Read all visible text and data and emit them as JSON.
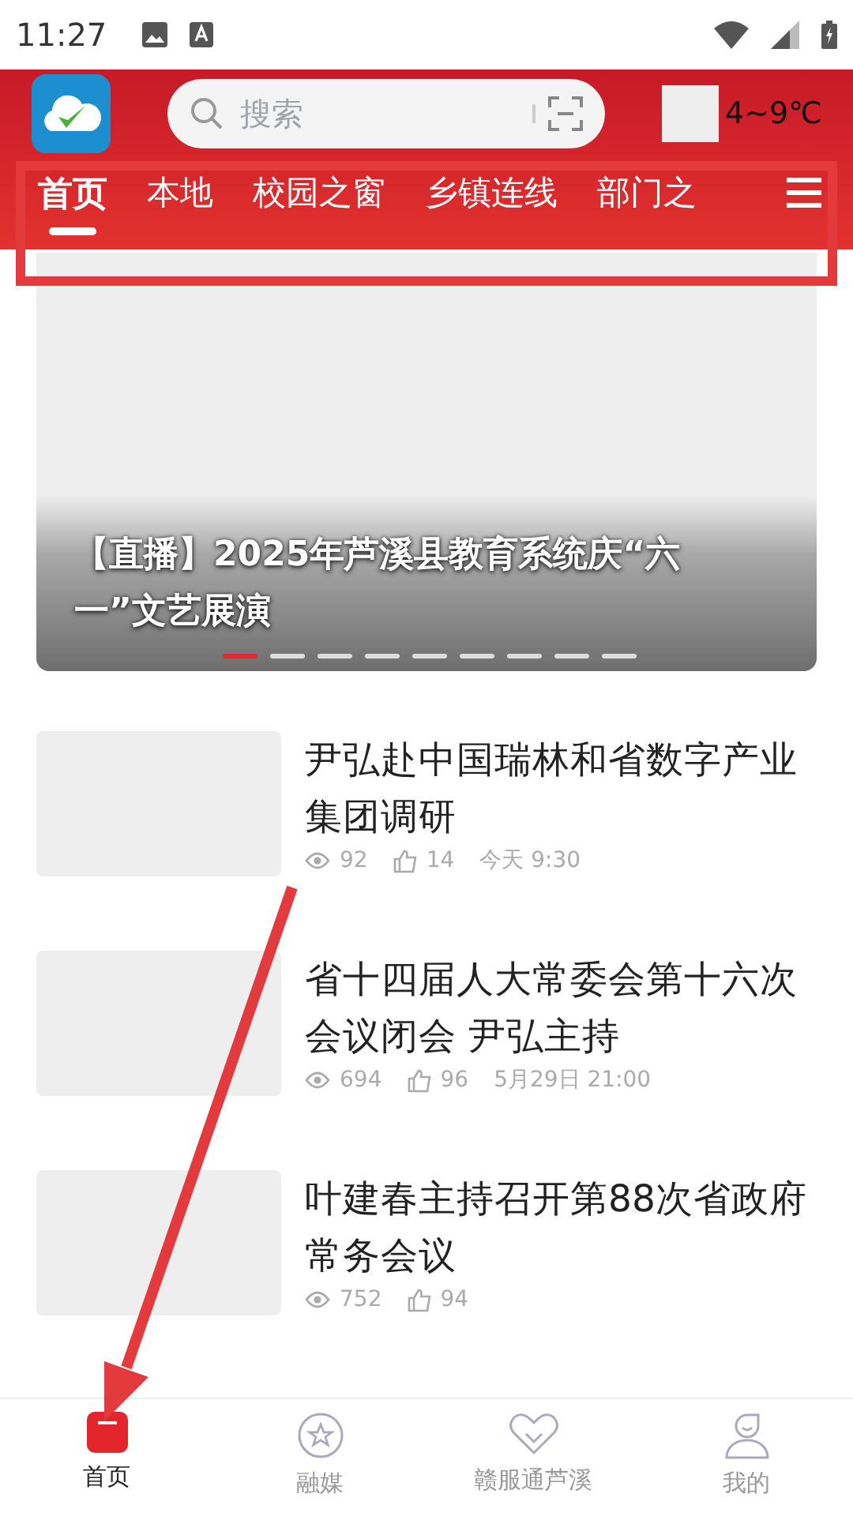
{
  "status_bar": {
    "time": "11:27"
  },
  "header": {
    "search": {
      "placeholder": "搜索"
    },
    "weather": "4~9℃"
  },
  "tabs": [
    {
      "label": "首页",
      "selected": true
    },
    {
      "label": "本地",
      "selected": false
    },
    {
      "label": "校园之窗",
      "selected": false
    },
    {
      "label": "乡镇连线",
      "selected": false
    },
    {
      "label": "部门之",
      "selected": false
    }
  ],
  "banner": {
    "title": "【直播】2025年芦溪县教育系统庆“六一”文艺展演",
    "pages": [
      {
        "selected": true
      },
      {
        "selected": false
      },
      {
        "selected": false
      },
      {
        "selected": false
      },
      {
        "selected": false
      },
      {
        "selected": false
      },
      {
        "selected": false
      },
      {
        "selected": false
      },
      {
        "selected": false
      }
    ]
  },
  "news": [
    {
      "title": "尹弘赴中国瑞林和省数字产业集团调研",
      "views": "92",
      "likes": "14",
      "time": "今天 9:30"
    },
    {
      "title": "省十四届人大常委会第十六次会议闭会 尹弘主持",
      "views": "694",
      "likes": "96",
      "time": "5月29日 21:00"
    },
    {
      "title": "叶建春主持召开第88次省政府常务会议",
      "views": "752",
      "likes": "94"
    }
  ],
  "bottom_nav": [
    {
      "label": "首页",
      "selected": true
    },
    {
      "label": "融媒",
      "selected": false
    },
    {
      "label": "赣服通芦溪",
      "selected": false
    },
    {
      "label": "我的",
      "selected": false
    }
  ]
}
